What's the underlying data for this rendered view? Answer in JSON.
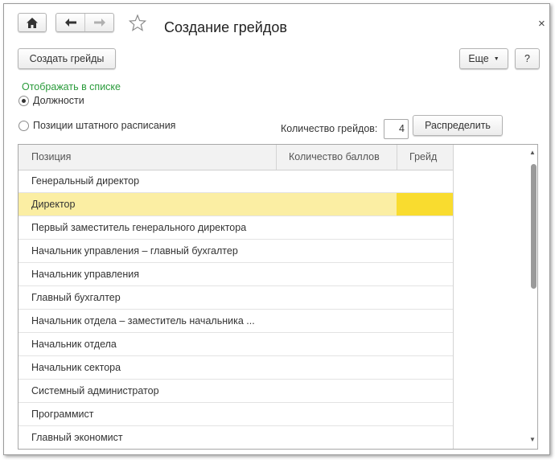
{
  "toolbar": {
    "title": "Создание грейдов",
    "home_icon": "home-icon",
    "back_icon": "arrow-left-icon",
    "forward_icon": "arrow-right-icon",
    "star_icon": "star-icon",
    "close": "×"
  },
  "actions": {
    "create_label": "Создать грейды",
    "more_label": "Еще",
    "help_label": "?"
  },
  "display": {
    "section_label": "Отображать в списке",
    "option_positions": "Должности",
    "option_staff": "Позиции штатного расписания",
    "selected": "positions"
  },
  "grades": {
    "count_label": "Количество грейдов:",
    "count_value": "4",
    "distribute_label": "Распределить"
  },
  "table": {
    "columns": [
      "Позиция",
      "Количество баллов",
      "Грейд"
    ],
    "rows": [
      {
        "position": "Генеральный директор",
        "points": "",
        "grade": ""
      },
      {
        "position": "Директор",
        "points": "",
        "grade": "",
        "selected": true
      },
      {
        "position": "Первый заместитель генерального директора",
        "points": "",
        "grade": ""
      },
      {
        "position": "Начальник управления – главный бухгалтер",
        "points": "",
        "grade": ""
      },
      {
        "position": "Начальник управления",
        "points": "",
        "grade": ""
      },
      {
        "position": "Главный бухгалтер",
        "points": "",
        "grade": ""
      },
      {
        "position": "Начальник отдела – заместитель начальника ...",
        "points": "",
        "grade": ""
      },
      {
        "position": "Начальник отдела",
        "points": "",
        "grade": ""
      },
      {
        "position": "Начальник сектора",
        "points": "",
        "grade": ""
      },
      {
        "position": "Системный администратор",
        "points": "",
        "grade": ""
      },
      {
        "position": "Программист",
        "points": "",
        "grade": ""
      },
      {
        "position": "Главный экономист",
        "points": "",
        "grade": ""
      }
    ]
  }
}
